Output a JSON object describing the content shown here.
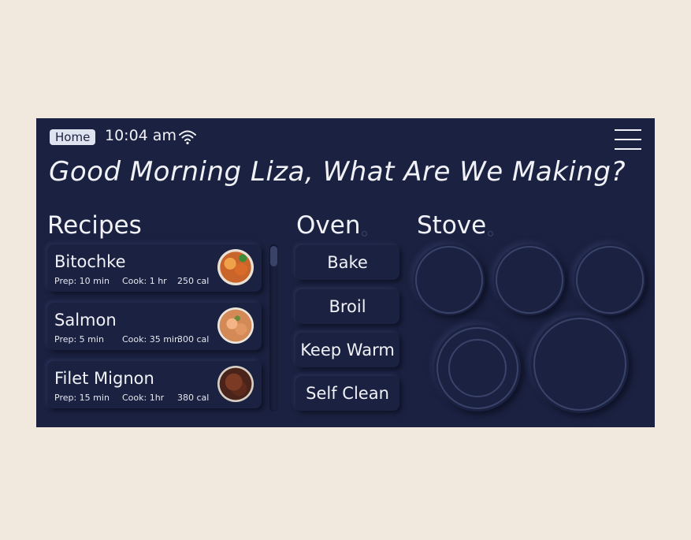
{
  "status": {
    "home_label": "Home",
    "time": "10:04 am",
    "wifi_icon": "wifi-icon",
    "menu_icon": "hamburger-menu-icon"
  },
  "greeting": "Good Morning Liza, What Are We Making?",
  "recipes": {
    "title": "Recipes",
    "items": [
      {
        "name": "Bitochke",
        "prep": "Prep: 10 min",
        "cook": "Cook: 1 hr",
        "cal": "250 cal"
      },
      {
        "name": "Salmon",
        "prep": "Prep: 5 min",
        "cook": "Cook: 35 min",
        "cal": "300 cal"
      },
      {
        "name": "Filet Mignon",
        "prep": "Prep: 15 min",
        "cook": "Cook: 1hr",
        "cal": "380 cal"
      }
    ]
  },
  "oven": {
    "title": "Oven",
    "buttons": [
      "Bake",
      "Broil",
      "Keep Warm",
      "Self Clean"
    ]
  },
  "stove": {
    "title": "Stove"
  },
  "colors": {
    "background": "#f2e9de",
    "panel": "#1b2140",
    "text": "#f1f2f7",
    "accent_ring": "#39436a"
  }
}
